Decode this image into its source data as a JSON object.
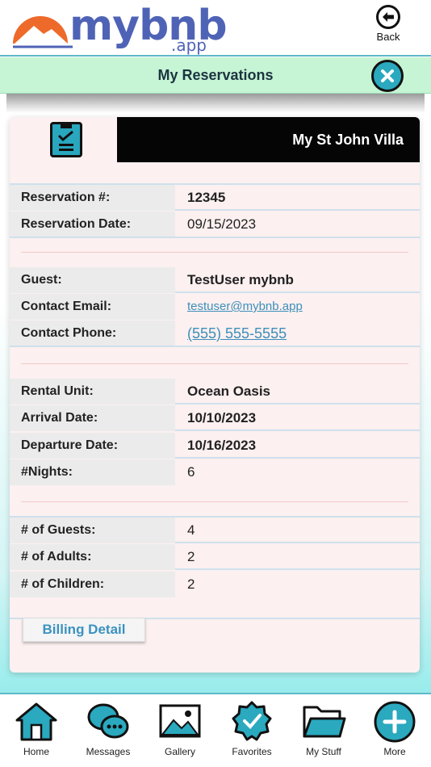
{
  "app": {
    "logo_word": "mybnb",
    "logo_suffix": ".app",
    "back_label": "Back"
  },
  "titlebar": {
    "title": "My Reservations"
  },
  "card": {
    "property_name": "My St John Villa",
    "sections": [
      {
        "rows": [
          {
            "label": "Reservation #:",
            "value": "12345"
          },
          {
            "label": "Reservation Date:",
            "value": "09/15/2023"
          }
        ]
      },
      {
        "rows": [
          {
            "label": "Guest:",
            "value": "TestUser mybnb"
          },
          {
            "label": "Contact Email:",
            "value": "testuser@mybnb.app"
          },
          {
            "label": "Contact Phone:",
            "value": "(555) 555-5555"
          }
        ]
      },
      {
        "rows": [
          {
            "label": "Rental Unit:",
            "value": "Ocean Oasis"
          },
          {
            "label": "Arrival Date:",
            "value": "10/10/2023"
          },
          {
            "label": "Departure Date:",
            "value": "10/16/2023"
          },
          {
            "label": "#Nights:",
            "value": "6"
          }
        ]
      },
      {
        "rows": [
          {
            "label": "# of Guests:",
            "value": "4"
          },
          {
            "label": "# of Adults:",
            "value": "2"
          },
          {
            "label": "# of Children:",
            "value": "2"
          }
        ]
      }
    ],
    "billing_button": "Billing Detail"
  },
  "bottom_nav": [
    {
      "label": "Home",
      "icon": "home-icon"
    },
    {
      "label": "Messages",
      "icon": "messages-icon"
    },
    {
      "label": "Gallery",
      "icon": "gallery-icon"
    },
    {
      "label": "Favorites",
      "icon": "favorites-icon"
    },
    {
      "label": "My Stuff",
      "icon": "folder-icon"
    },
    {
      "label": "More",
      "icon": "plus-icon"
    }
  ],
  "colors": {
    "accent": "#2aa9bf",
    "logo": "#4f63b6",
    "logo_sun": "#ee6a2a",
    "titlebar_bg": "#c5f5d4",
    "link": "#3b8fba"
  }
}
